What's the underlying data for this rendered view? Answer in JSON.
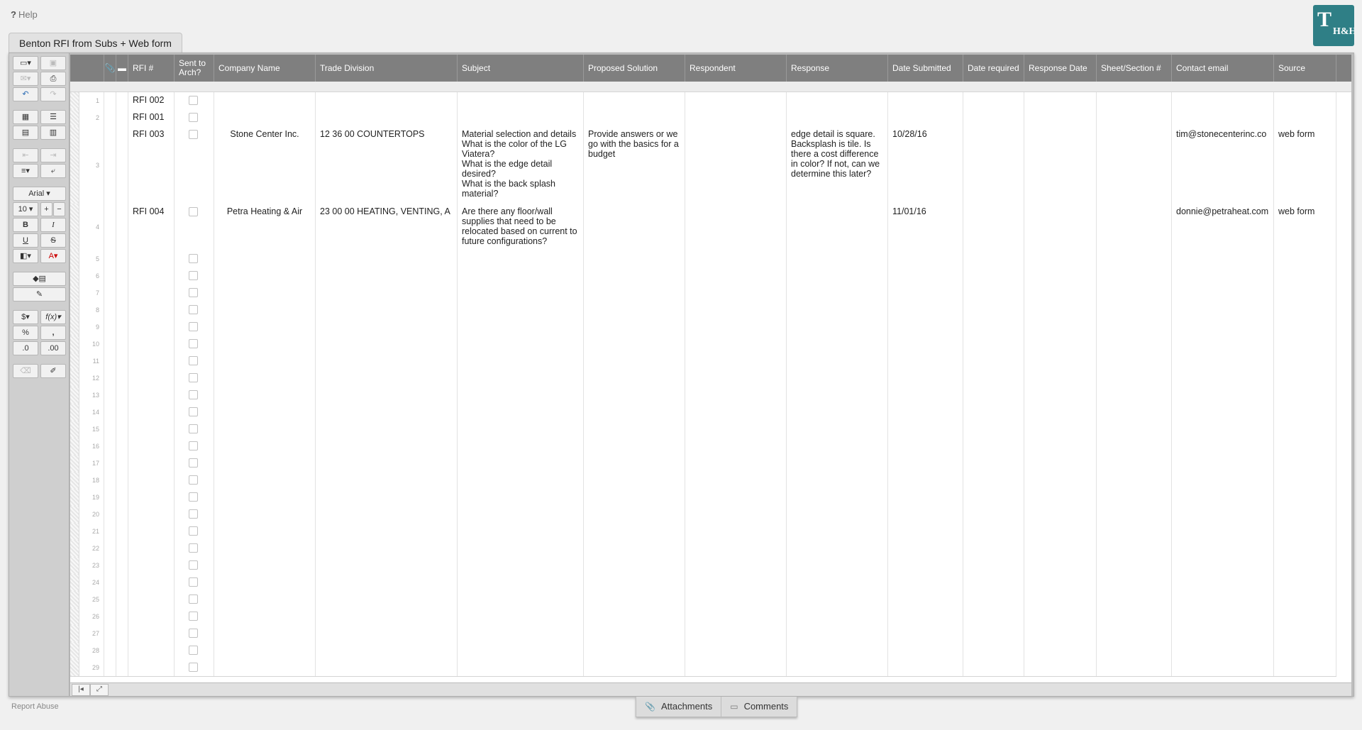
{
  "help": {
    "icon": "?",
    "label": "Help"
  },
  "logo": {
    "letter": "T",
    "sub": "H&H"
  },
  "sheet_tab": "Benton RFI from Subs + Web form",
  "toolbar": {
    "font_name": "Arial",
    "font_size": "10"
  },
  "columns": [
    {
      "key": "rfi",
      "label": "RFI #"
    },
    {
      "key": "sent",
      "label": "Sent to Arch?"
    },
    {
      "key": "company",
      "label": "Company Name"
    },
    {
      "key": "trade",
      "label": "Trade Division"
    },
    {
      "key": "subject",
      "label": "Subject"
    },
    {
      "key": "solution",
      "label": "Proposed Solution"
    },
    {
      "key": "respondent",
      "label": "Respondent"
    },
    {
      "key": "response",
      "label": "Response"
    },
    {
      "key": "submitted",
      "label": "Date Submitted"
    },
    {
      "key": "required",
      "label": "Date required"
    },
    {
      "key": "respdate",
      "label": "Response Date"
    },
    {
      "key": "sheet",
      "label": "Sheet/Section #"
    },
    {
      "key": "email",
      "label": "Contact email"
    },
    {
      "key": "source",
      "label": "Source"
    }
  ],
  "rows": [
    {
      "num": "1",
      "rfi": "RFI 002",
      "company": "",
      "trade": "",
      "subject": "",
      "solution": "",
      "respondent": "",
      "response": "",
      "submitted": "",
      "required": "",
      "respdate": "",
      "sheet": "",
      "email": "",
      "source": ""
    },
    {
      "num": "2",
      "rfi": "RFI 001",
      "company": "",
      "trade": "",
      "subject": "",
      "solution": "",
      "respondent": "",
      "response": "",
      "submitted": "",
      "required": "",
      "respdate": "",
      "sheet": "",
      "email": "",
      "source": ""
    },
    {
      "num": "3",
      "rfi": "RFI 003",
      "company": "Stone Center Inc.",
      "trade": "12 36 00 COUNTERTOPS",
      "subject": "Material selection and details\nWhat is the color of the LG Viatera?\nWhat is the edge detail desired?\nWhat is the back splash material?",
      "solution": "Provide answers or we go with the basics for a budget",
      "respondent": "",
      "response": "edge detail is square. Backsplash is tile. Is there a cost difference in color? If not, can we determine this later?",
      "submitted": "10/28/16",
      "required": "",
      "respdate": "",
      "sheet": "",
      "email": "tim@stonecenterinc.co",
      "source": "web form"
    },
    {
      "num": "4",
      "rfi": "RFI 004",
      "company": "Petra Heating & Air",
      "trade": "23 00 00 HEATING, VENTING, A",
      "subject": "Are there any floor/wall supplies that need to be relocated based on current to future configurations?",
      "solution": "",
      "respondent": "",
      "response": "",
      "submitted": "11/01/16",
      "required": "",
      "respdate": "",
      "sheet": "",
      "email": "donnie@petraheat.com",
      "source": "web form"
    }
  ],
  "empty_rows": [
    "5",
    "6",
    "7",
    "8",
    "9",
    "10",
    "11",
    "12",
    "13",
    "14",
    "15",
    "16",
    "17",
    "18",
    "19",
    "20",
    "21",
    "22",
    "23",
    "24",
    "25",
    "26",
    "27",
    "28",
    "29"
  ],
  "footer": {
    "report": "Report Abuse",
    "attachments": "Attachments",
    "comments": "Comments"
  }
}
